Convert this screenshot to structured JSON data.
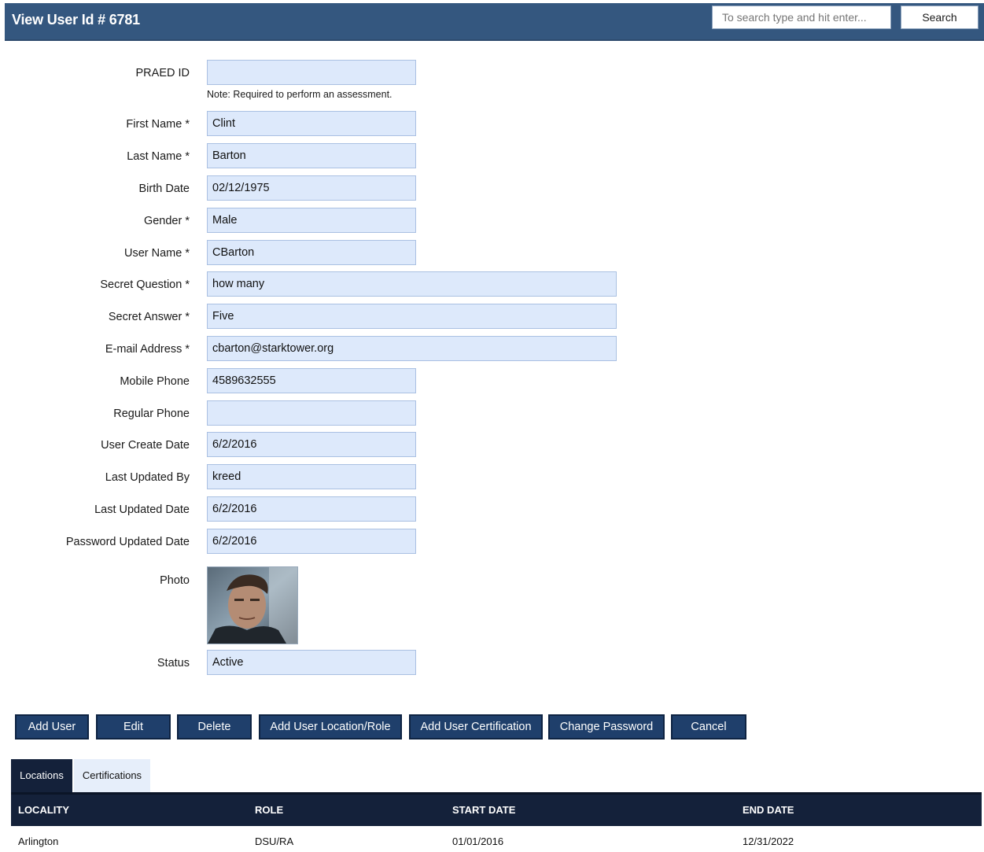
{
  "header": {
    "title": "View User Id # 6781",
    "search_placeholder": "To search type and hit enter...",
    "search_button": "Search"
  },
  "form": {
    "praed_id": {
      "label": "PRAED ID",
      "value": "",
      "note": "Note: Required to perform an assessment."
    },
    "first_name": {
      "label": "First Name *",
      "value": "Clint"
    },
    "last_name": {
      "label": "Last Name *",
      "value": "Barton"
    },
    "birth_date": {
      "label": "Birth Date",
      "value": "02/12/1975"
    },
    "gender": {
      "label": "Gender *",
      "value": "Male"
    },
    "user_name": {
      "label": "User Name *",
      "value": "CBarton"
    },
    "secret_question": {
      "label": "Secret Question *",
      "value": "how many"
    },
    "secret_answer": {
      "label": "Secret Answer *",
      "value": "Five"
    },
    "email": {
      "label": "E-mail Address *",
      "value": "cbarton@starktower.org"
    },
    "mobile_phone": {
      "label": "Mobile Phone",
      "value": "4589632555"
    },
    "regular_phone": {
      "label": "Regular Phone",
      "value": ""
    },
    "user_create_date": {
      "label": "User Create Date",
      "value": "6/2/2016"
    },
    "last_updated_by": {
      "label": "Last Updated By",
      "value": "kreed"
    },
    "last_updated_date": {
      "label": "Last Updated Date",
      "value": "6/2/2016"
    },
    "password_updated_date": {
      "label": "Password Updated Date",
      "value": "6/2/2016"
    },
    "photo": {
      "label": "Photo"
    },
    "status": {
      "label": "Status",
      "value": "Active"
    }
  },
  "actions": {
    "add_user": "Add User",
    "edit": "Edit",
    "delete": "Delete",
    "add_location_role": "Add User Location/Role",
    "add_certification": "Add User Certification",
    "change_password": "Change Password",
    "cancel": "Cancel"
  },
  "tabs": {
    "locations": "Locations",
    "certifications": "Certifications"
  },
  "table": {
    "columns": [
      "LOCALITY",
      "ROLE",
      "START DATE",
      "END DATE"
    ],
    "rows": [
      [
        "Arlington",
        "DSU/RA",
        "01/01/2016",
        "12/31/2022"
      ]
    ]
  },
  "colors": {
    "header_bg": "#34577f",
    "field_bg": "#dde9fb",
    "button_bg": "#1f3f6b",
    "table_header_bg": "#14213a"
  }
}
